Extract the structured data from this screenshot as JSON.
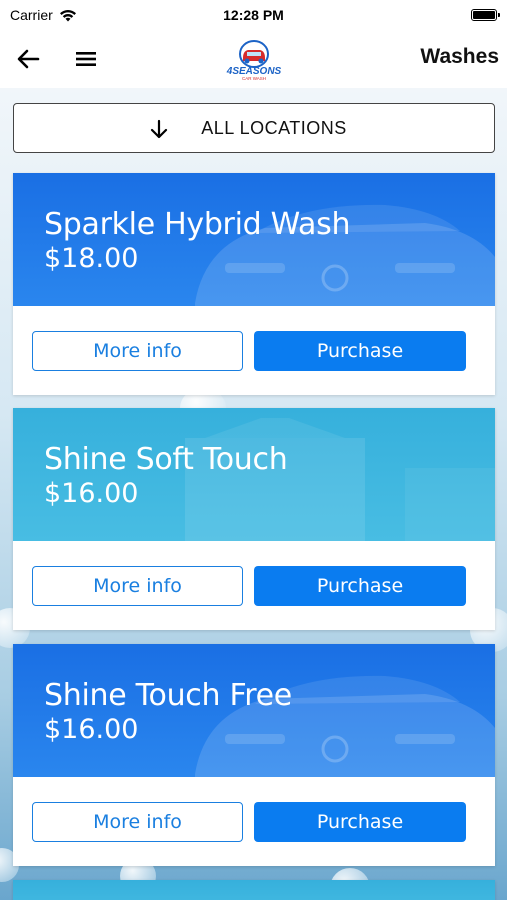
{
  "status_bar": {
    "carrier": "Carrier",
    "time": "12:28 PM"
  },
  "nav": {
    "title": "Washes",
    "logo_text": "4SEASONS",
    "logo_subtext": "CAR WASH"
  },
  "filter": {
    "location_label": "ALL LOCATIONS"
  },
  "colors": {
    "primary_blue": "#0a7cf0",
    "hero_blue": "#1e78e6",
    "hero_cyan": "#3fb6de"
  },
  "washes": [
    {
      "name": "Sparkle Hybrid Wash",
      "price": "$18.00",
      "more_info_label": "More info",
      "purchase_label": "Purchase"
    },
    {
      "name": "Shine Soft Touch",
      "price": "$16.00",
      "more_info_label": "More info",
      "purchase_label": "Purchase"
    },
    {
      "name": "Shine Touch Free",
      "price": "$16.00",
      "more_info_label": "More info",
      "purchase_label": "Purchase"
    }
  ]
}
